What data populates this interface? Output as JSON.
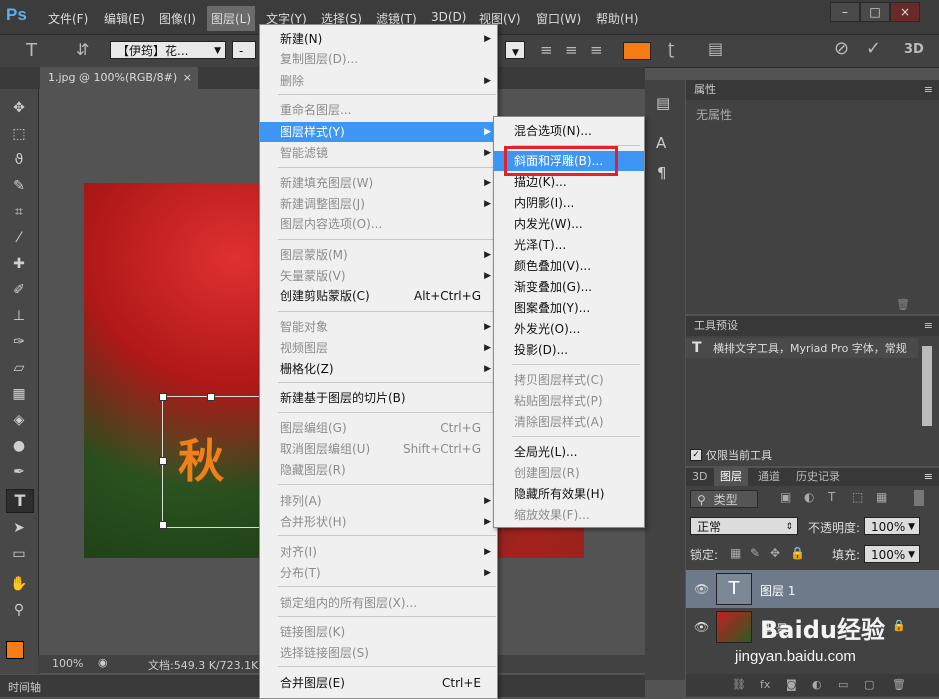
{
  "app": {
    "logo": "Ps"
  },
  "menubar": {
    "items": [
      "文件(F)",
      "编辑(E)",
      "图像(I)",
      "图层(L)",
      "文字(Y)",
      "选择(S)",
      "滤镜(T)",
      "3D(D)",
      "视图(V)",
      "窗口(W)",
      "帮助(H)"
    ],
    "window_buttons": [
      "–",
      "□",
      "×"
    ]
  },
  "options_bar": {
    "font_family": "【伊筠】花...",
    "font_size_value": "-",
    "color": "#f57b15",
    "mode_3d": "3D"
  },
  "document": {
    "tab_label": "1.jpg @ 100%(RGB/8#)",
    "close_glyph": "×",
    "canvas_text": "秋"
  },
  "status_bar": {
    "zoom": "100%",
    "doc_size": "文档:549.3 K/723.1K",
    "timeline_label": "时间轴"
  },
  "layer_menu": {
    "items": [
      {
        "label": "新建(N)",
        "shortcut": "",
        "submenu": true,
        "disabled": false
      },
      {
        "label": "复制图层(D)...",
        "shortcut": "",
        "submenu": false,
        "disabled": true
      },
      {
        "label": "删除",
        "shortcut": "",
        "submenu": true,
        "disabled": true
      },
      {
        "label": "重命名图层...",
        "shortcut": "",
        "submenu": false,
        "disabled": true
      },
      {
        "label": "图层样式(Y)",
        "shortcut": "",
        "submenu": true,
        "disabled": false,
        "highlight": true
      },
      {
        "label": "智能滤镜",
        "shortcut": "",
        "submenu": true,
        "disabled": true
      },
      {
        "label": "新建填充图层(W)",
        "shortcut": "",
        "submenu": true,
        "disabled": true
      },
      {
        "label": "新建调整图层(J)",
        "shortcut": "",
        "submenu": true,
        "disabled": true
      },
      {
        "label": "图层内容选项(O)...",
        "shortcut": "",
        "submenu": false,
        "disabled": true
      },
      {
        "label": "图层蒙版(M)",
        "shortcut": "",
        "submenu": true,
        "disabled": true
      },
      {
        "label": "矢量蒙版(V)",
        "shortcut": "",
        "submenu": true,
        "disabled": true
      },
      {
        "label": "创建剪贴蒙版(C)",
        "shortcut": "Alt+Ctrl+G",
        "submenu": false,
        "disabled": false
      },
      {
        "label": "智能对象",
        "shortcut": "",
        "submenu": true,
        "disabled": true
      },
      {
        "label": "视频图层",
        "shortcut": "",
        "submenu": true,
        "disabled": true
      },
      {
        "label": "栅格化(Z)",
        "shortcut": "",
        "submenu": true,
        "disabled": false
      },
      {
        "label": "新建基于图层的切片(B)",
        "shortcut": "",
        "submenu": false,
        "disabled": false
      },
      {
        "label": "图层编组(G)",
        "shortcut": "Ctrl+G",
        "submenu": false,
        "disabled": true
      },
      {
        "label": "取消图层编组(U)",
        "shortcut": "Shift+Ctrl+G",
        "submenu": false,
        "disabled": true
      },
      {
        "label": "隐藏图层(R)",
        "shortcut": "",
        "submenu": false,
        "disabled": true
      },
      {
        "label": "排列(A)",
        "shortcut": "",
        "submenu": true,
        "disabled": true
      },
      {
        "label": "合并形状(H)",
        "shortcut": "",
        "submenu": true,
        "disabled": true
      },
      {
        "label": "对齐(I)",
        "shortcut": "",
        "submenu": true,
        "disabled": true
      },
      {
        "label": "分布(T)",
        "shortcut": "",
        "submenu": true,
        "disabled": true
      },
      {
        "label": "锁定组内的所有图层(X)...",
        "shortcut": "",
        "submenu": false,
        "disabled": true
      },
      {
        "label": "链接图层(K)",
        "shortcut": "",
        "submenu": false,
        "disabled": true
      },
      {
        "label": "选择链接图层(S)",
        "shortcut": "",
        "submenu": false,
        "disabled": true
      },
      {
        "label": "合并图层(E)",
        "shortcut": "Ctrl+E",
        "submenu": false,
        "disabled": false
      }
    ]
  },
  "style_submenu": {
    "items": [
      {
        "label": "混合选项(N)...",
        "disabled": false
      },
      {
        "label": "斜面和浮雕(B)...",
        "disabled": false,
        "highlight": true
      },
      {
        "label": "描边(K)...",
        "disabled": false
      },
      {
        "label": "内阴影(I)...",
        "disabled": false
      },
      {
        "label": "内发光(W)...",
        "disabled": false
      },
      {
        "label": "光泽(T)...",
        "disabled": false
      },
      {
        "label": "颜色叠加(V)...",
        "disabled": false
      },
      {
        "label": "渐变叠加(G)...",
        "disabled": false
      },
      {
        "label": "图案叠加(Y)...",
        "disabled": false
      },
      {
        "label": "外发光(O)...",
        "disabled": false
      },
      {
        "label": "投影(D)...",
        "disabled": false
      },
      {
        "label": "拷贝图层样式(C)",
        "disabled": true
      },
      {
        "label": "粘贴图层样式(P)",
        "disabled": true
      },
      {
        "label": "清除图层样式(A)",
        "disabled": true
      },
      {
        "label": "全局光(L)...",
        "disabled": false
      },
      {
        "label": "创建图层(R)",
        "disabled": true
      },
      {
        "label": "隐藏所有效果(H)",
        "disabled": false
      },
      {
        "label": "缩放效果(F)...",
        "disabled": true
      }
    ]
  },
  "properties_panel": {
    "title": "属性",
    "empty_text": "无属性"
  },
  "tool_presets_panel": {
    "title": "工具预设",
    "preset_text": "横排文字工具，Myriad Pro 字体，常规",
    "current_only_label": "仅限当前工具"
  },
  "layers_panel": {
    "tabs": [
      "3D",
      "图层",
      "通道",
      "历史记录"
    ],
    "filter_label": "类型",
    "blend_mode": "正常",
    "opacity_label": "不透明度:",
    "opacity_value": "100%",
    "lock_label": "锁定:",
    "fill_label": "填充:",
    "fill_value": "100%",
    "layers": [
      {
        "name": "图层 1",
        "type_glyph": "T",
        "selected": true
      },
      {
        "name": "背景",
        "type_glyph": "",
        "selected": false
      }
    ]
  },
  "watermark": {
    "text": "Baidu经验",
    "url": "jingyan.baidu.com"
  }
}
